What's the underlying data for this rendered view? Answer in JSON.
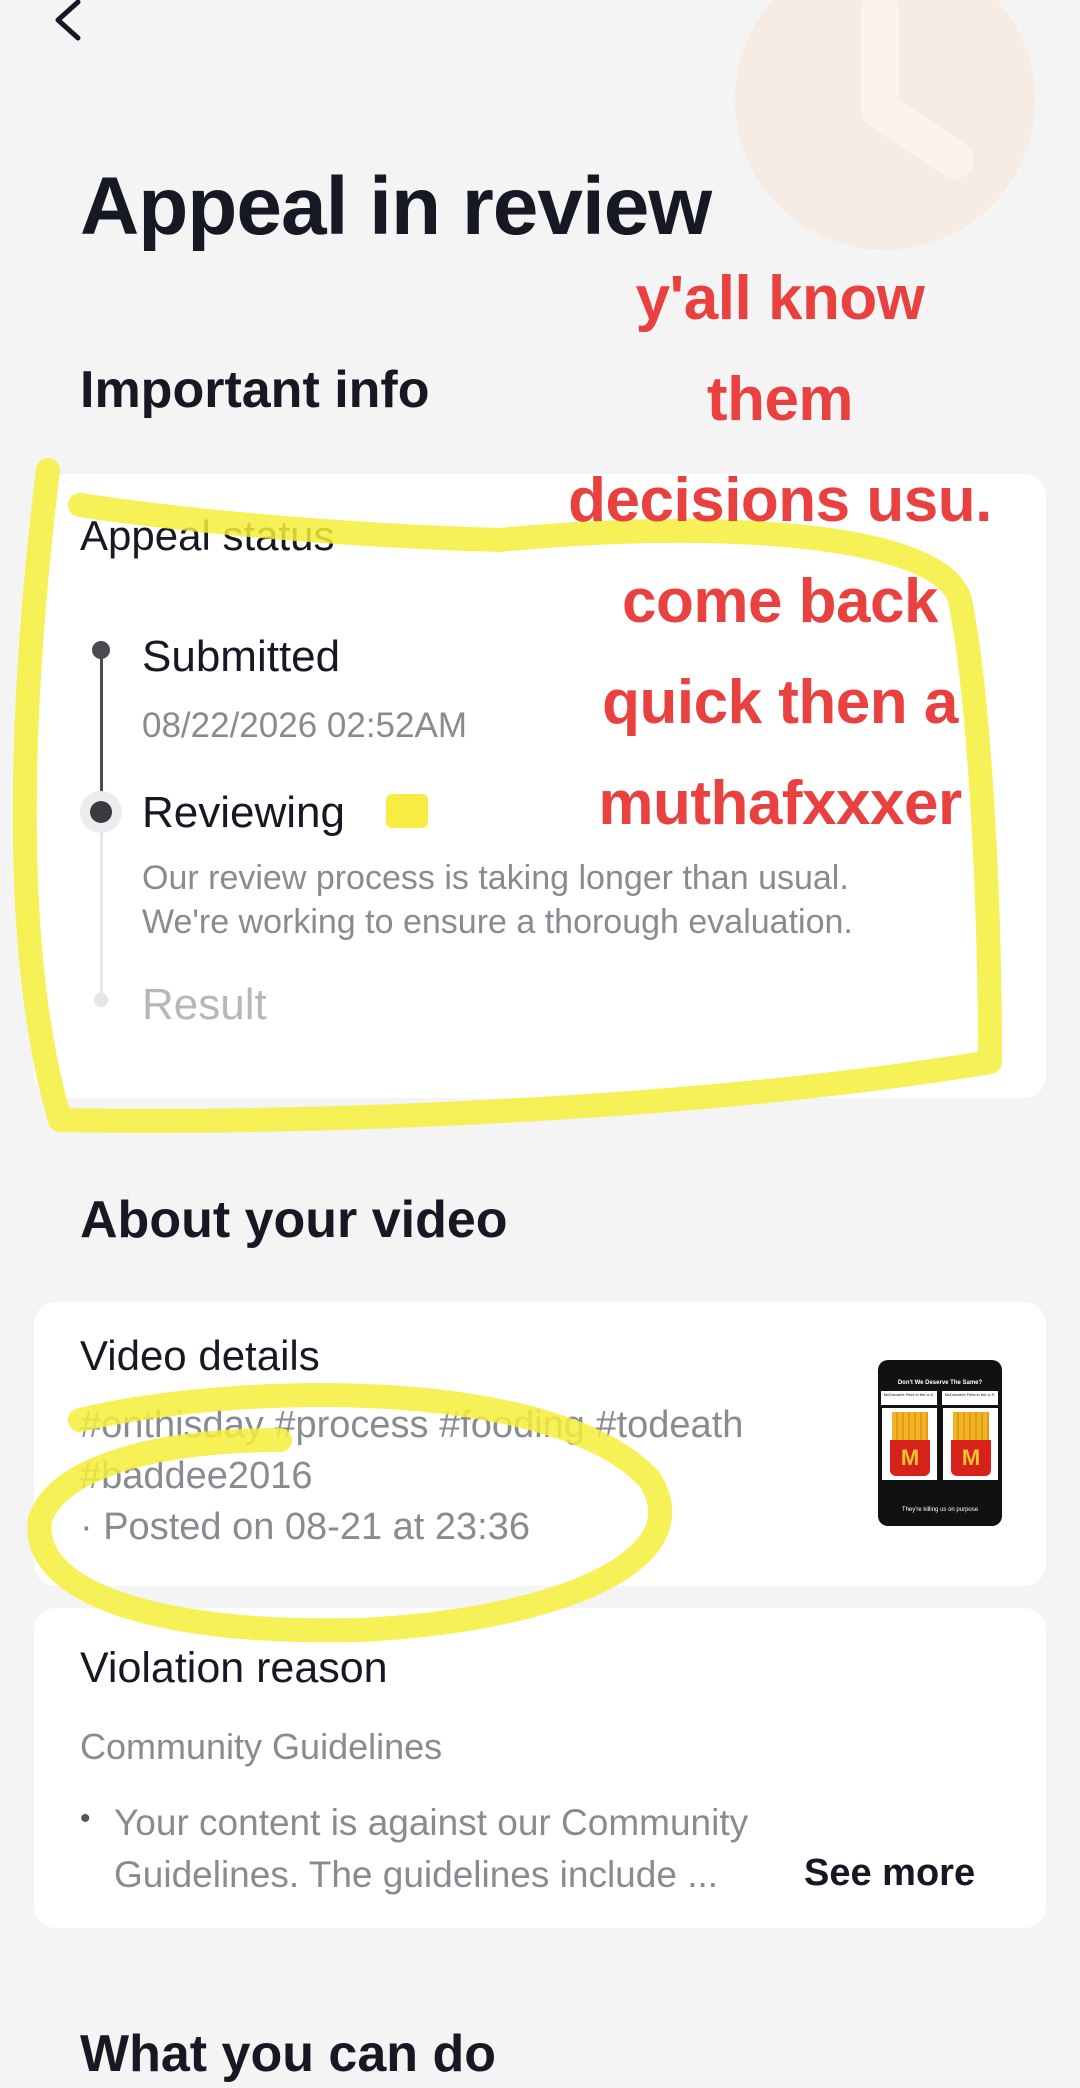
{
  "header": {
    "title": "Appeal in review"
  },
  "important_info": {
    "heading": "Important info",
    "card_title": "Appeal status",
    "steps": [
      {
        "label": "Submitted",
        "detail": "08/22/2026 02:52AM"
      },
      {
        "label": "Reviewing",
        "detail_line1": "Our review process is taking longer than usual.",
        "detail_line2": "We're working to ensure a thorough evaluation."
      },
      {
        "label": "Result"
      }
    ]
  },
  "about_video": {
    "heading": "About your video",
    "card_title": "Video details",
    "tags_line1": "#onthisday #process #fooding #todeath",
    "tags_line2": "#baddee2016",
    "posted": "· Posted on 08-21 at 23:36",
    "thumbnail": {
      "top_text": "Don't We Deserve The Same?",
      "left_caption": "McDonald's Fries in the U.K.",
      "right_caption": "McDonald's Fries in the U.S.",
      "bottom_text": "They're killing us on purpose"
    }
  },
  "violation": {
    "title": "Violation reason",
    "category": "Community Guidelines",
    "text_line1": "Your content is against our Community",
    "text_line2": "Guidelines. The guidelines include ...",
    "see_more": "See more"
  },
  "what_you_can_do": {
    "heading": "What you can do"
  },
  "overlay_caption": {
    "lines": [
      "y'all know",
      "them",
      "decisions usu.",
      "come back",
      "quick then a",
      "muthafxxxer"
    ]
  },
  "icons": {
    "back": "chevron-left-icon",
    "decoration": "clock-icon"
  },
  "colors": {
    "overlay_text": "#e8413f",
    "highlighter": "#f5ee3a",
    "background": "#f4f4f5"
  }
}
